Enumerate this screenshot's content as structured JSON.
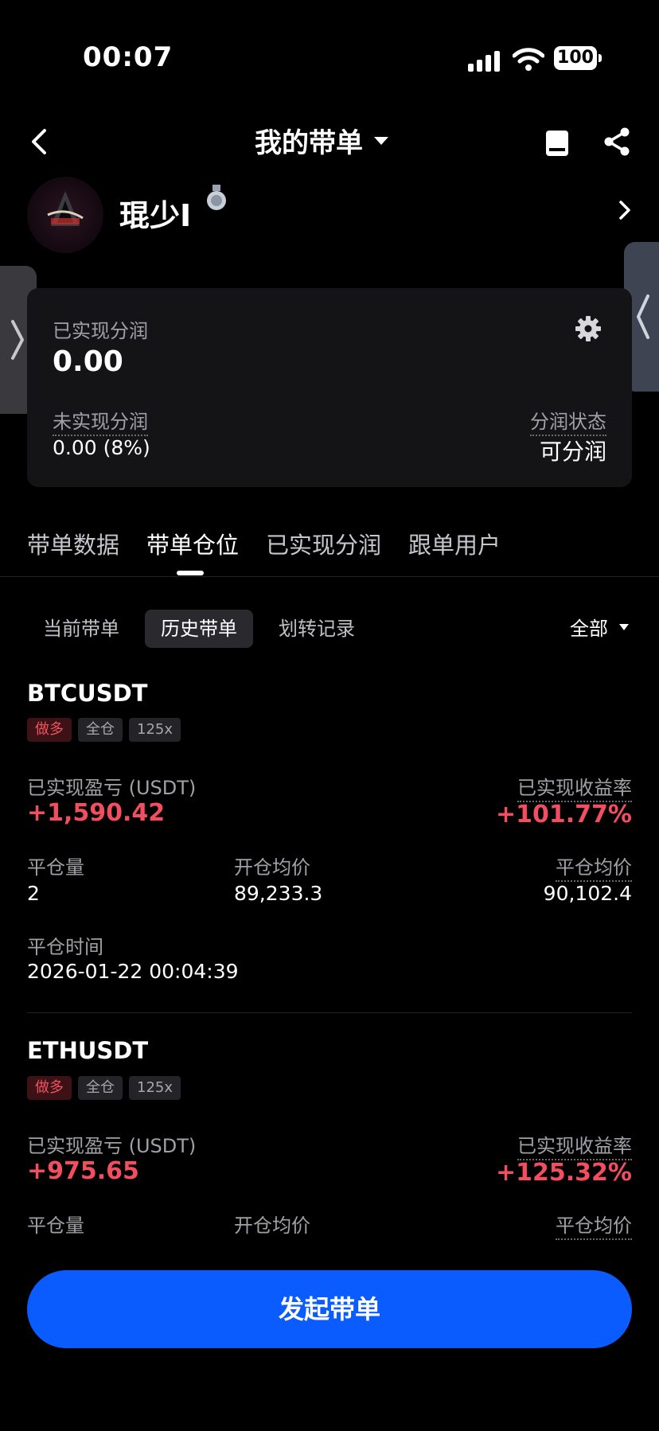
{
  "status_bar": {
    "time": "00:07",
    "battery": "100"
  },
  "header": {
    "title": "我的带单"
  },
  "profile": {
    "name": "琨少I"
  },
  "summary": {
    "realized_label": "已实现分润",
    "realized_value": "0.00",
    "unrealized_label": "未实现分润",
    "unrealized_value": "0.00 (8%)",
    "status_label": "分润状态",
    "status_value": "可分润"
  },
  "tabs": [
    {
      "label": "带单数据"
    },
    {
      "label": "带单仓位"
    },
    {
      "label": "已实现分润"
    },
    {
      "label": "跟单用户"
    }
  ],
  "subtabs": [
    {
      "label": "当前带单"
    },
    {
      "label": "历史带单"
    },
    {
      "label": "划转记录"
    }
  ],
  "filter": {
    "label": "全部"
  },
  "labels": {
    "pnl": "已实现盈亏 (USDT)",
    "roi": "已实现收益率",
    "close_qty": "平仓量",
    "open_avg": "开仓均价",
    "close_avg": "平仓均价",
    "close_time": "平仓时间"
  },
  "positions": [
    {
      "symbol": "BTCUSDT",
      "side": "做多",
      "margin": "全仓",
      "leverage": "125x",
      "pnl": "+1,590.42",
      "roi": "+101.77%",
      "close_qty": "2",
      "open_avg": "89,233.3",
      "close_avg": "90,102.4",
      "close_time": "2026-01-22 00:04:39"
    },
    {
      "symbol": "ETHUSDT",
      "side": "做多",
      "margin": "全仓",
      "leverage": "125x",
      "pnl": "+975.65",
      "roi": "+125.32%"
    }
  ],
  "cta": {
    "label": "发起带单"
  },
  "colors": {
    "accent": "#0a5cff",
    "profit": "#f24e60",
    "background": "#000000"
  }
}
